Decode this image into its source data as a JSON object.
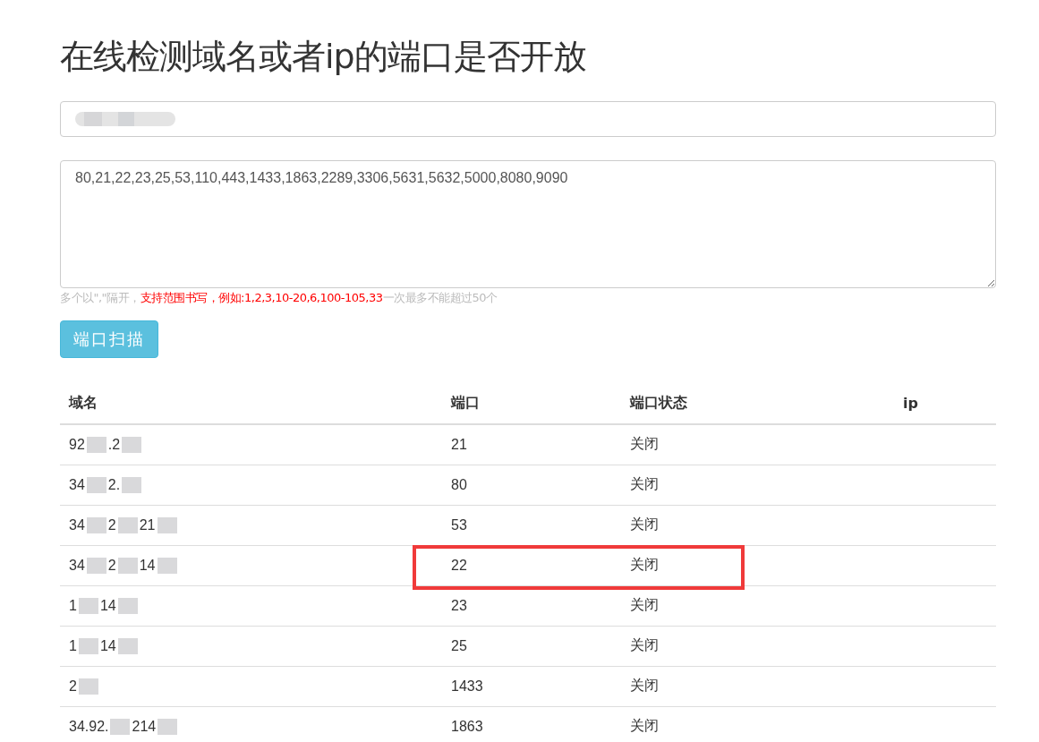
{
  "title": "在线检测域名或者ip的端口是否开放",
  "ports_field": {
    "value": "80,21,22,23,25,53,110,443,1433,1863,2289,3306,5631,5632,5000,8080,9090"
  },
  "hint": "多个以\",\"隔开，**支持范围书写，例如:1,2,3,10-20,6,100-105,33**一次最多不能超过50个",
  "scan_button": "端口扫描",
  "table": {
    "columns": [
      "域名",
      "端口",
      "端口状态",
      "ip"
    ],
    "rows": [
      {
        "domain_parts": [
          "92",
          ".2"
        ],
        "port": "21",
        "status": "关闭",
        "highlighted": false
      },
      {
        "domain_parts": [
          "34",
          "2."
        ],
        "port": "80",
        "status": "关闭",
        "highlighted": false
      },
      {
        "domain_parts": [
          "34",
          "2",
          "21"
        ],
        "port": "53",
        "status": "关闭",
        "highlighted": false
      },
      {
        "domain_parts": [
          "34",
          "2",
          "14"
        ],
        "port": "22",
        "status": "关闭",
        "highlighted": true
      },
      {
        "domain_parts": [
          "1",
          "14"
        ],
        "port": "23",
        "status": "关闭",
        "highlighted": false
      },
      {
        "domain_parts": [
          "1",
          "14"
        ],
        "port": "25",
        "status": "关闭",
        "highlighted": false
      },
      {
        "domain_parts": [
          "2"
        ],
        "port": "1433",
        "status": "关闭",
        "highlighted": false
      },
      {
        "domain_parts": [
          "34.92.",
          "214"
        ],
        "port": "1863",
        "status": "关闭",
        "highlighted": false
      }
    ]
  }
}
